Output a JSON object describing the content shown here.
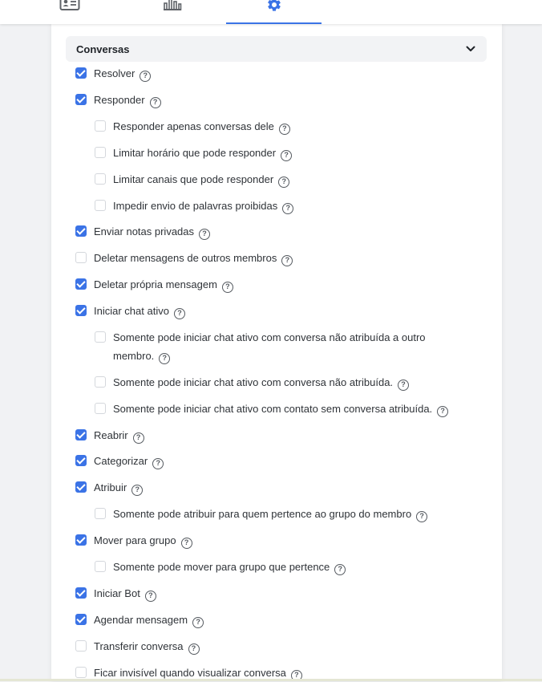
{
  "tabs": [
    {
      "name": "contact",
      "icon": "contact-card-icon"
    },
    {
      "name": "stats",
      "icon": "bar-chart-icon"
    },
    {
      "name": "settings",
      "icon": "gear-icon",
      "active": true
    }
  ],
  "colors": {
    "accent": "#3b73e6",
    "header_bg": "#f2f3f5",
    "page_bg": "#f1f2f4"
  },
  "section": {
    "title": "Conversas",
    "expanded": true
  },
  "permissions": [
    {
      "label": "Resolver",
      "checked": true
    },
    {
      "label": "Responder",
      "checked": true
    },
    {
      "label": "Responder apenas conversas dele",
      "checked": false
    },
    {
      "label": "Limitar horário que pode responder",
      "checked": false
    },
    {
      "label": "Limitar canais que pode responder",
      "checked": false
    },
    {
      "label": "Impedir envio de palavras proibidas",
      "checked": false
    },
    {
      "label": "Enviar notas privadas",
      "checked": true
    },
    {
      "label": "Deletar mensagens de outros membros",
      "checked": false
    },
    {
      "label": "Deletar própria mensagem",
      "checked": true
    },
    {
      "label": "Iniciar chat ativo",
      "checked": true
    },
    {
      "label": "Somente pode iniciar chat ativo com conversa não atribuída a outro membro.",
      "checked": false
    },
    {
      "label": "Somente pode iniciar chat ativo com conversa não atribuída.",
      "checked": false
    },
    {
      "label": "Somente pode iniciar chat ativo com contato sem conversa atribuída.",
      "checked": false
    },
    {
      "label": "Reabrir",
      "checked": true
    },
    {
      "label": "Categorizar",
      "checked": true
    },
    {
      "label": "Atribuir",
      "checked": true
    },
    {
      "label": "Somente pode atribuir para quem pertence ao grupo do membro",
      "checked": false
    },
    {
      "label": "Mover para grupo",
      "checked": true
    },
    {
      "label": "Somente pode mover para grupo que pertence",
      "checked": false
    },
    {
      "label": "Iniciar Bot",
      "checked": true
    },
    {
      "label": "Agendar mensagem",
      "checked": true
    },
    {
      "label": "Transferir conversa",
      "checked": false
    },
    {
      "label": "Ficar invisível quando visualizar conversa",
      "checked": false
    }
  ]
}
